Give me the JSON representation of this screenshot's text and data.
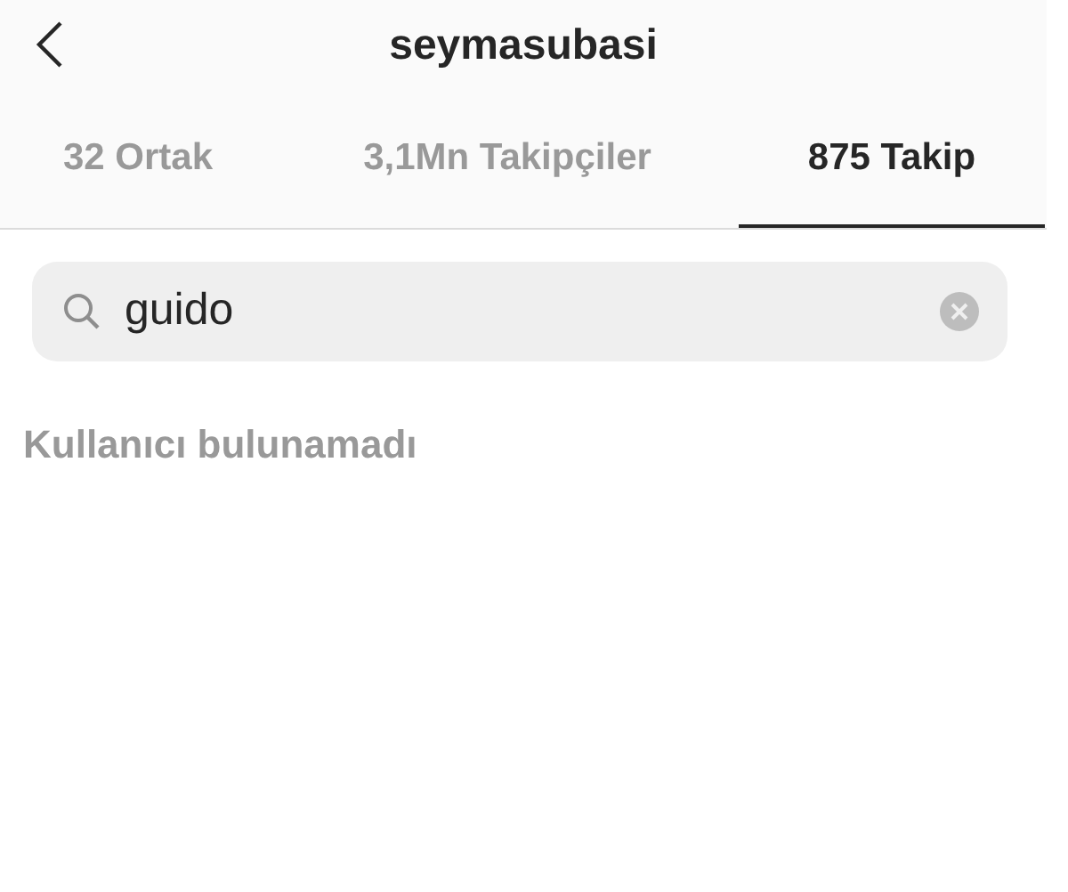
{
  "header": {
    "title": "seymasubasi"
  },
  "tabs": [
    {
      "label": "32 Ortak",
      "selected": false
    },
    {
      "label": "3,1Mn Takipçiler",
      "selected": false
    },
    {
      "label": "875 Takip",
      "selected": true
    }
  ],
  "search": {
    "value": "guido"
  },
  "message": "Kullanıcı bulunamadı"
}
